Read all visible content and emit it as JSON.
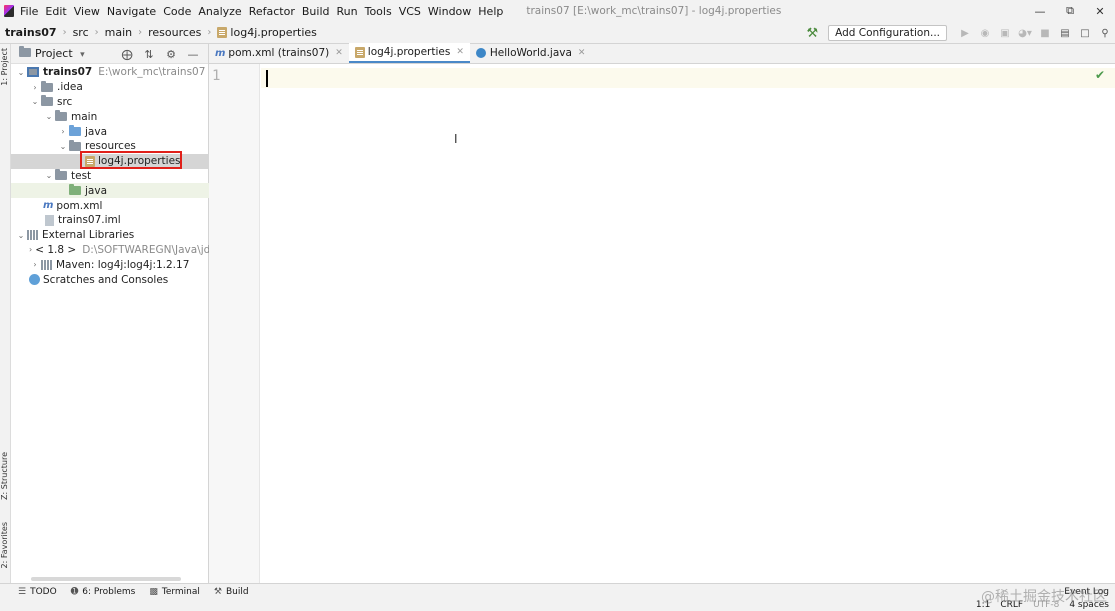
{
  "menu": {
    "items": [
      "File",
      "Edit",
      "View",
      "Navigate",
      "Code",
      "Analyze",
      "Refactor",
      "Build",
      "Run",
      "Tools",
      "VCS",
      "Window",
      "Help"
    ],
    "window_title": "trains07 [E:\\work_mc\\trains07] - log4j.properties"
  },
  "breadcrumb": [
    "trains07",
    "src",
    "main",
    "resources",
    "log4j.properties"
  ],
  "toolbar": {
    "add_configuration": "Add Configuration..."
  },
  "side_tabs": {
    "project": "1: Project",
    "structure": "Z: Structure",
    "favorites": "2: Favorites"
  },
  "project_panel": {
    "title": "Project",
    "tree": {
      "root": "trains07",
      "root_path": "E:\\work_mc\\trains07",
      "idea": ".idea",
      "src": "src",
      "main": "main",
      "java": "java",
      "resources": "resources",
      "log4j": "log4j.properties",
      "test": "test",
      "test_java": "java",
      "pom": "pom.xml",
      "iml": "trains07.iml",
      "external": "External Libraries",
      "jdk": "< 1.8 >",
      "jdk_path": "D:\\SOFTWAREGN\\Java\\jd",
      "maven": "Maven: log4j:log4j:1.2.17",
      "scratches": "Scratches and Consoles"
    }
  },
  "editor_tabs": [
    {
      "label": "pom.xml (trains07)"
    },
    {
      "label": "log4j.properties"
    },
    {
      "label": "HelloWorld.java"
    }
  ],
  "editor": {
    "line_number": "1"
  },
  "statusbar": {
    "todo": "TODO",
    "problems": "6: Problems",
    "terminal": "Terminal",
    "build": "Build",
    "event_log": "Event Log",
    "position": "1:1",
    "line_sep": "CRLF",
    "encoding": "UTF-8",
    "indent": "4 spaces"
  },
  "watermark": "@稀土掘金技术社区"
}
